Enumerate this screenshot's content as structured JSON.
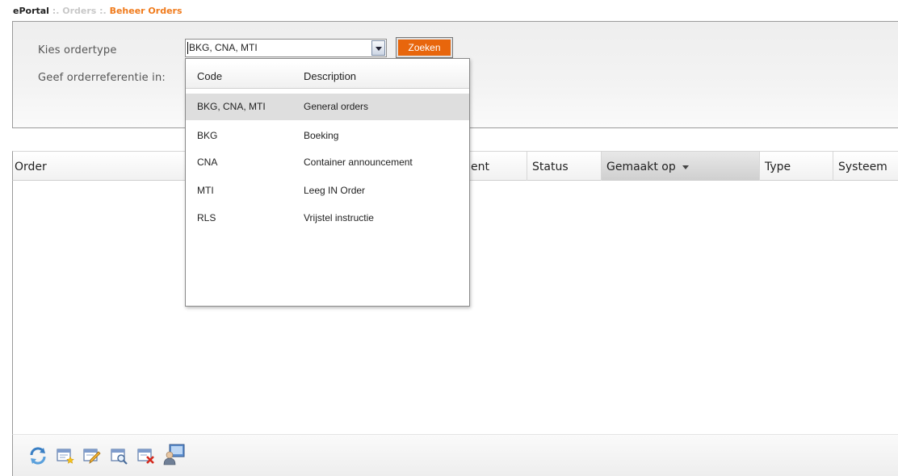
{
  "breadcrumb": {
    "root": "ePortal",
    "sep1": " :. ",
    "mid": "Orders",
    "sep2": " :. ",
    "current": "Beheer Orders"
  },
  "search": {
    "ordertype_label": "Kies ordertype",
    "reference_label": "Geef orderreferentie in:",
    "ordertype_value": "BKG, CNA, MTI",
    "search_button": "Zoeken"
  },
  "dropdown": {
    "columns": [
      "Code",
      "Description"
    ],
    "options": [
      {
        "code": "BKG, CNA, MTI",
        "description": "General orders",
        "selected": true
      },
      {
        "code": "BKG",
        "description": "Boeking",
        "selected": false
      },
      {
        "code": "CNA",
        "description": "Container announcement",
        "selected": false
      },
      {
        "code": "MTI",
        "description": "Leeg IN Order",
        "selected": false
      },
      {
        "code": "RLS",
        "description": "Vrijstel instructie",
        "selected": false
      }
    ]
  },
  "grid": {
    "columns": {
      "order": "Order",
      "ent": "ent",
      "status": "Status",
      "gemaakt_op": "Gemaakt op",
      "type": "Type",
      "systeem": "Systeem"
    },
    "sort_column": "gemaakt_op"
  },
  "toolbar": {
    "buttons": [
      "refresh-icon",
      "new-order-icon",
      "edit-order-icon",
      "view-order-icon",
      "delete-order-icon",
      "user-screen-icon"
    ]
  },
  "colors": {
    "accent": "#f07b1c",
    "button": "#e8660c",
    "selected_row": "#dedede"
  }
}
